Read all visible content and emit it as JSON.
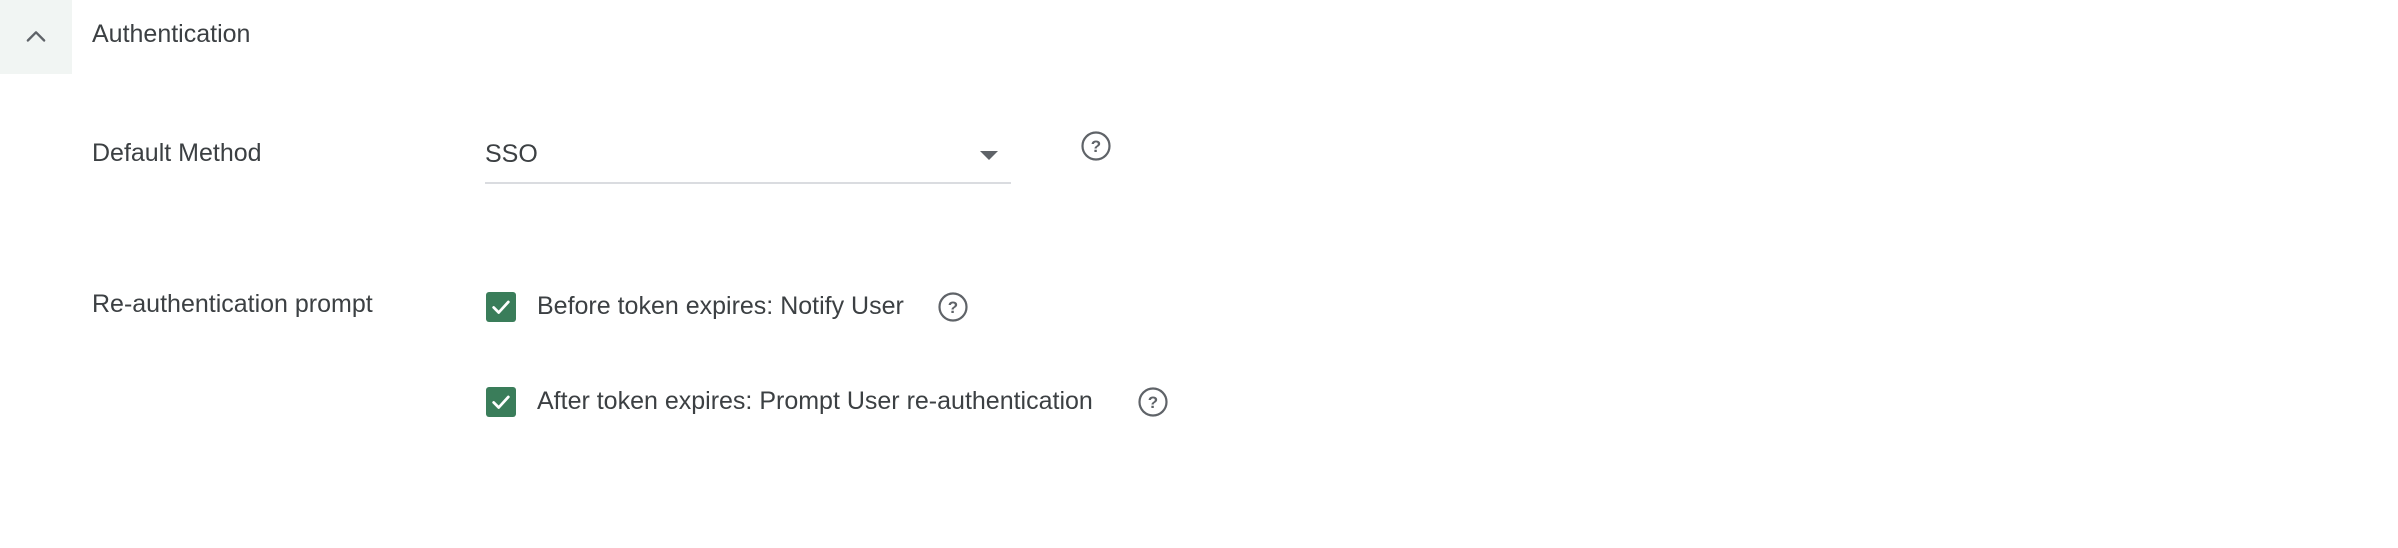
{
  "section": {
    "title": "Authentication",
    "toggle_icon": "chevron-up-icon"
  },
  "default_method": {
    "label": "Default Method",
    "value": "SSO",
    "caret_icon": "caret-down-icon",
    "help_icon": "help-circle-icon"
  },
  "reauth": {
    "label": "Re-authentication prompt",
    "options": [
      {
        "label": "Before token expires: Notify User",
        "checked": true,
        "help_icon": "help-circle-icon"
      },
      {
        "label": "After token expires: Prompt User re-authentication",
        "checked": true,
        "help_icon": "help-circle-icon"
      }
    ]
  },
  "colors": {
    "accent": "#3a7d5a",
    "text": "#3c4043",
    "toggle_bg": "#f1f5f3",
    "divider": "#dadce0"
  }
}
